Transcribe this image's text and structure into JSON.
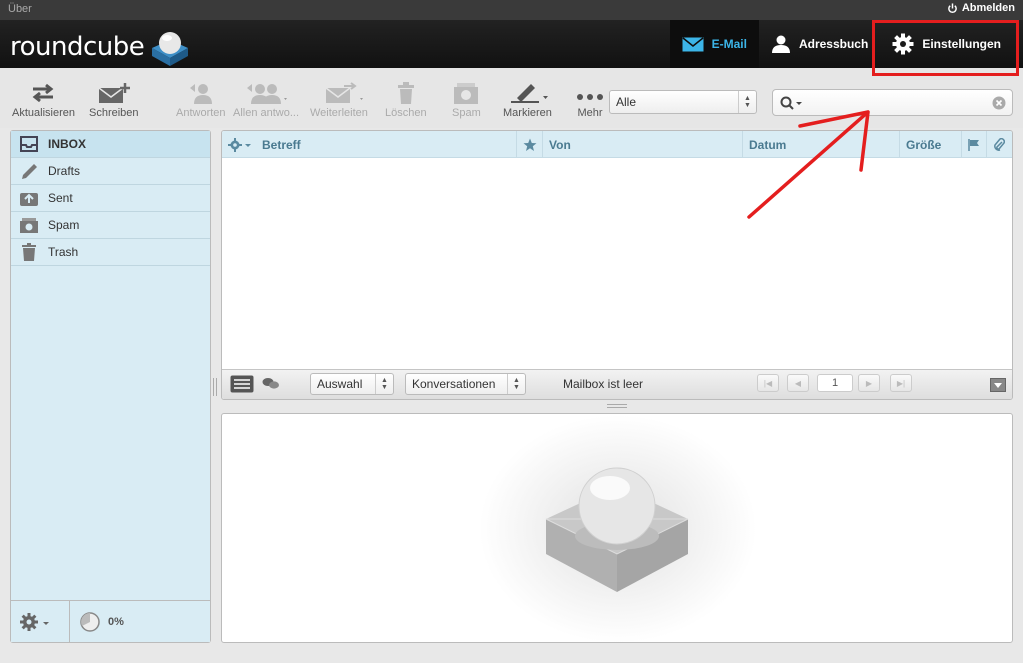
{
  "topline": {
    "about": "Über",
    "logout": "Abmelden"
  },
  "logo": {
    "text": "roundcube"
  },
  "nav": {
    "mail": "E-Mail",
    "addressbook": "Adressbuch",
    "settings": "Einstellungen"
  },
  "toolbar": {
    "refresh": "Aktualisieren",
    "compose": "Schreiben",
    "reply": "Antworten",
    "reply_all": "Allen antwo...",
    "forward": "Weiterleiten",
    "delete": "Löschen",
    "spam": "Spam",
    "mark": "Markieren",
    "more": "Mehr",
    "filter_value": "Alle",
    "search_placeholder": ""
  },
  "folders": [
    {
      "label": "INBOX",
      "icon": "inbox-icon",
      "selected": true
    },
    {
      "label": "Drafts",
      "icon": "pencil-icon"
    },
    {
      "label": "Sent",
      "icon": "sent-icon"
    },
    {
      "label": "Spam",
      "icon": "spam-icon"
    },
    {
      "label": "Trash",
      "icon": "trash-icon"
    }
  ],
  "quota": "0%",
  "list": {
    "columns": {
      "subject": "Betreff",
      "from": "Von",
      "date": "Datum",
      "size": "Größe"
    },
    "select_label": "Auswahl",
    "threads_label": "Konversationen",
    "status": "Mailbox ist leer",
    "page": "1"
  },
  "colors": {
    "accent": "#3cb5e8",
    "highlight": "#e41e1e",
    "panel": "#d9ecf4"
  }
}
